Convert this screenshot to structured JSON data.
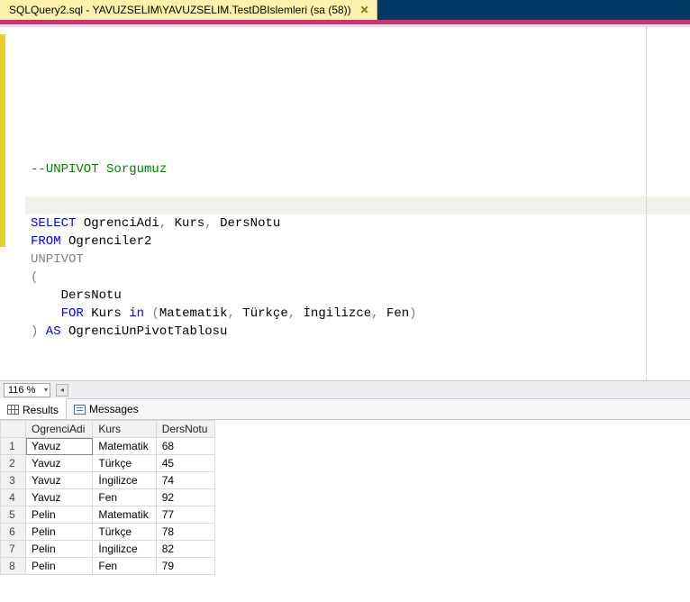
{
  "tab": {
    "title": "SQLQuery2.sql - YAVUZSELIM\\YAVUZSELIM.TestDBIslemleri (sa (58))",
    "close_glyph": "✕"
  },
  "editor": {
    "comment": "--UNPIVOT Sorgumuz",
    "kw_select": "SELECT",
    "sel_cols": " OgrenciAdi",
    "sel_sep1": ",",
    "sel_col2": " Kurs",
    "sel_sep2": ",",
    "sel_col3": " DersNotu",
    "kw_from": "FROM",
    "from_tbl": " Ogrenciler2",
    "kw_unpivot": "UNPIVOT",
    "paren_open": "(",
    "indent1": "    DersNotu",
    "kw_for_pad": "    ",
    "kw_for": "FOR",
    "for_col": " Kurs ",
    "kw_in": "in",
    "in_open": " (",
    "in_1": "Matematik",
    "in_s1": ",",
    "in_2": " Türkçe",
    "in_s2": ",",
    "in_3": " İngilizce",
    "in_s3": ",",
    "in_4": " Fen",
    "in_close": ")",
    "paren_close": ")",
    "kw_as": " AS ",
    "alias": "OgrenciUnPivotTablosu"
  },
  "zoom": {
    "value": "116 %",
    "caret": "▾",
    "scroll_left": "◂"
  },
  "results": {
    "tab_results": "Results",
    "tab_messages": "Messages",
    "columns": [
      "OgrenciAdi",
      "Kurs",
      "DersNotu"
    ],
    "rows": [
      {
        "n": "1",
        "OgrenciAdi": "Yavuz",
        "Kurs": "Matematik",
        "DersNotu": "68"
      },
      {
        "n": "2",
        "OgrenciAdi": "Yavuz",
        "Kurs": "Türkçe",
        "DersNotu": "45"
      },
      {
        "n": "3",
        "OgrenciAdi": "Yavuz",
        "Kurs": "İngilizce",
        "DersNotu": "74"
      },
      {
        "n": "4",
        "OgrenciAdi": "Yavuz",
        "Kurs": "Fen",
        "DersNotu": "92"
      },
      {
        "n": "5",
        "OgrenciAdi": "Pelin",
        "Kurs": "Matematik",
        "DersNotu": "77"
      },
      {
        "n": "6",
        "OgrenciAdi": "Pelin",
        "Kurs": "Türkçe",
        "DersNotu": "78"
      },
      {
        "n": "7",
        "OgrenciAdi": "Pelin",
        "Kurs": "İngilizce",
        "DersNotu": "82"
      },
      {
        "n": "8",
        "OgrenciAdi": "Pelin",
        "Kurs": "Fen",
        "DersNotu": "79"
      }
    ]
  }
}
